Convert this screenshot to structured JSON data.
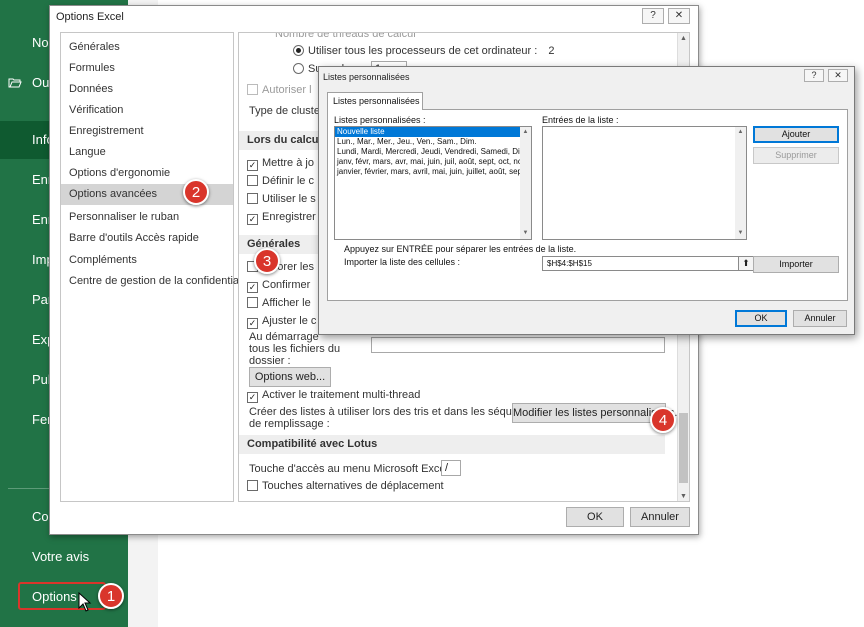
{
  "backstage": {
    "items": [
      {
        "label": "No",
        "icon": "new-icon"
      },
      {
        "label": "Ou",
        "icon": "folder-open-icon"
      },
      {
        "label": "Info"
      },
      {
        "label": "Enr"
      },
      {
        "label": "Enr"
      },
      {
        "label": "Imp"
      },
      {
        "label": "Par"
      },
      {
        "label": "Exp"
      },
      {
        "label": "Pul"
      },
      {
        "label": "Fer"
      }
    ],
    "bottom_items": [
      {
        "label": "Co"
      },
      {
        "label": "Votre avis"
      },
      {
        "label": "Options"
      }
    ],
    "colors": {
      "background": "#217346",
      "active": "#0f5a30"
    }
  },
  "badges": [
    "1",
    "2",
    "3",
    "4"
  ],
  "options_dialog": {
    "title": "Options Excel",
    "help_label": "?",
    "close_label": "✕",
    "nav_items": [
      "Générales",
      "Formules",
      "Données",
      "Vérification",
      "Enregistrement",
      "Langue",
      "Options d'ergonomie",
      "Options avancées",
      "Personnaliser le ruban",
      "Barre d'outils Accès rapide",
      "Compléments",
      "Centre de gestion de la confidentialité"
    ],
    "selected_nav": "Options avancées",
    "content": {
      "top_cut_text": "Nombre de threads de calcul",
      "radio_all_processors": "Utiliser tous les processeurs de cet ordinateur :",
      "processor_count": "2",
      "radio_manual": "Sur ordre",
      "manual_value": "1",
      "allow_user": "Autoriser l",
      "cluster_type": "Type de cluste",
      "section_calc": "Lors du calcul d",
      "calc_options": [
        "Mettre à jo",
        "Définir le c",
        "Utiliser le s",
        "Enregistrer"
      ],
      "section_general": "Générales",
      "general_options": [
        "Ignorer les",
        "Confirmer",
        "Afficher le",
        "Ajuster le c"
      ],
      "startup_text_1": "Au démarrage",
      "startup_text_2": "tous les fichiers du",
      "startup_text_3": "dossier :",
      "web_options_button": "Options web...",
      "multithread": "Activer le traitement multi-thread",
      "create_lists_text_1": "Créer des listes à utiliser lors des tris et dans les séquences",
      "create_lists_text_2": "de remplissage :",
      "modify_lists_button": "Modifier les listes personnalisées...",
      "section_lotus": "Compatibilité avec Lotus",
      "menu_key_label": "Touche d'accès au menu  Microsoft Excel :",
      "menu_key_value": "/",
      "alt_nav_keys": "Touches alternatives de déplacement"
    },
    "ok_label": "OK",
    "cancel_label": "Annuler"
  },
  "lists_dialog": {
    "title": "Listes personnalisées",
    "help_label": "?",
    "close_label": "✕",
    "tab_label": "Listes personnalisées",
    "lists_label": "Listes personnalisées :",
    "entries_label": "Entrées de la liste :",
    "lists": [
      "Nouvelle liste",
      "Lun., Mar., Mer., Jeu., Ven., Sam., Dim.",
      "Lundi, Mardi, Mercredi, Jeudi, Vendredi, Samedi, Dim",
      "janv, févr, mars, avr, mai, juin, juil, août, sept, oct, no",
      "janvier, février, mars, avril, mai, juin, juillet, août, sep"
    ],
    "selected_list": "Nouvelle liste",
    "add_button": "Ajouter",
    "delete_button": "Supprimer",
    "hint_text": "Appuyez sur ENTRÉE pour séparer les entrées de la liste.",
    "import_label": "Importer la liste des cellules :",
    "import_value": "$H$4:$H$15",
    "import_button": "Importer",
    "ok_label": "OK",
    "cancel_label": "Annuler"
  }
}
